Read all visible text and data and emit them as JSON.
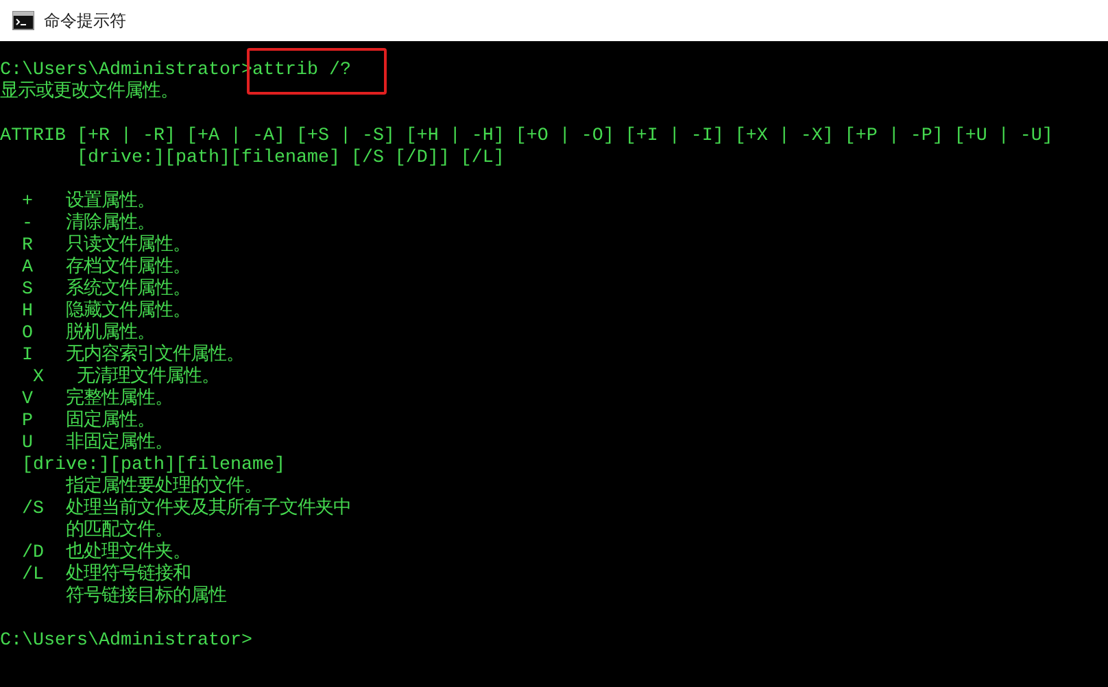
{
  "window": {
    "title": "命令提示符"
  },
  "command_line": {
    "prompt": "C:\\Users\\Administrator>",
    "command": "attrib /?",
    "highlighted": true
  },
  "output_blocks": [
    [
      "显示或更改文件属性。"
    ],
    [
      "ATTRIB [+R | -R] [+A | -A] [+S | -S] [+H | -H] [+O | -O] [+I | -I] [+X | -X] [+P | -P] [+U | -U]",
      "       [drive:][path][filename] [/S [/D]] [/L]"
    ],
    [
      "  +   设置属性。",
      "  -   清除属性。",
      "  R   只读文件属性。",
      "  A   存档文件属性。",
      "  S   系统文件属性。",
      "  H   隐藏文件属性。",
      "  O   脱机属性。",
      "  I   无内容索引文件属性。",
      "   X   无清理文件属性。",
      "  V   完整性属性。",
      "  P   固定属性。",
      "  U   非固定属性。",
      "  [drive:][path][filename]",
      "      指定属性要处理的文件。",
      "  /S  处理当前文件夹及其所有子文件夹中",
      "      的匹配文件。",
      "  /D  也处理文件夹。",
      "  /L  处理符号链接和",
      "      符号链接目标的属性"
    ]
  ],
  "final_prompt": "C:\\Users\\Administrator>"
}
